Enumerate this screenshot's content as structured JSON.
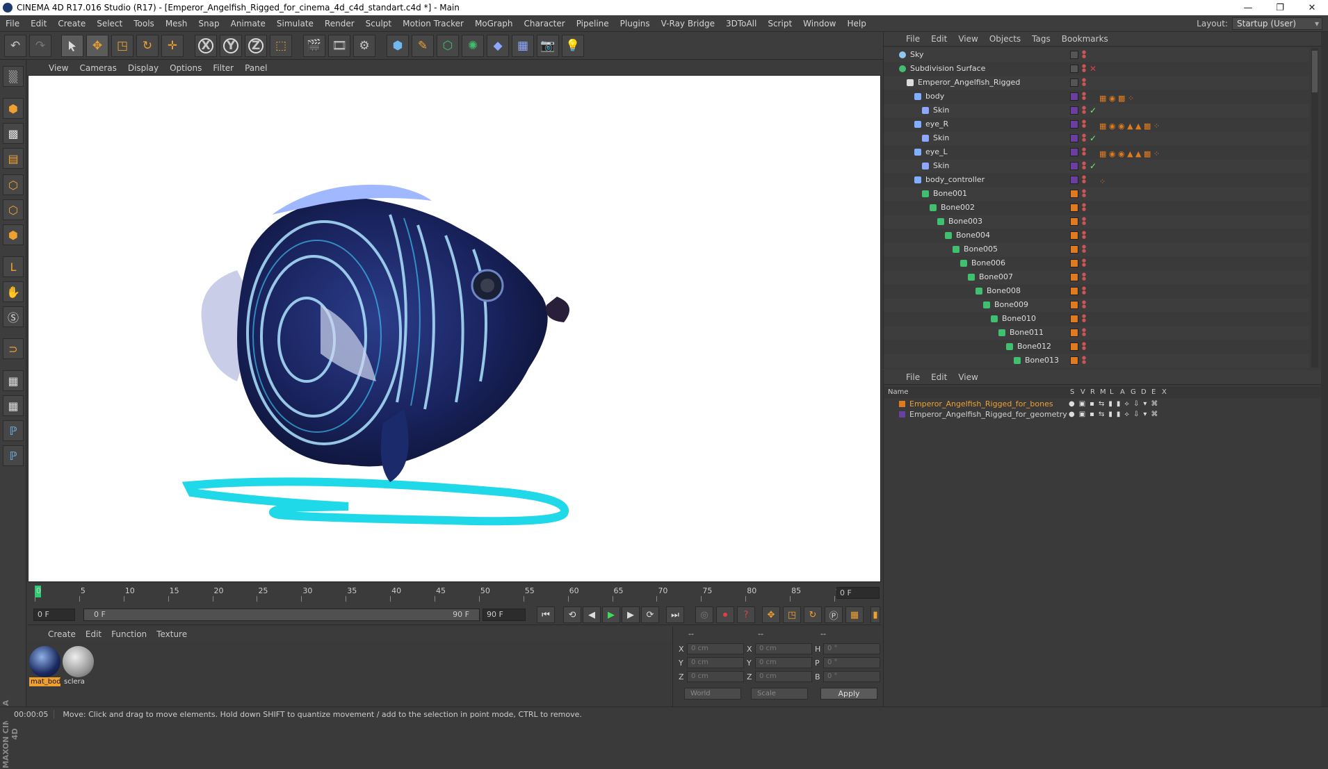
{
  "window": {
    "title": "CINEMA 4D R17.016 Studio (R17) - [Emperor_Angelfish_Rigged_for_cinema_4d_c4d_standart.c4d *] - Main"
  },
  "menubar": [
    "File",
    "Edit",
    "Create",
    "Select",
    "Tools",
    "Mesh",
    "Snap",
    "Animate",
    "Simulate",
    "Render",
    "Sculpt",
    "Motion Tracker",
    "MoGraph",
    "Character",
    "Pipeline",
    "Plugins",
    "V-Ray Bridge",
    "3DToAll",
    "Script",
    "Window",
    "Help"
  ],
  "layout": {
    "label": "Layout:",
    "value": "Startup (User)"
  },
  "toolbar_axes": [
    "X",
    "Y",
    "Z"
  ],
  "viewport": {
    "menu": [
      "View",
      "Cameras",
      "Display",
      "Options",
      "Filter",
      "Panel"
    ]
  },
  "timeline": {
    "ticks": [
      "0",
      "5",
      "10",
      "15",
      "20",
      "25",
      "30",
      "35",
      "40",
      "45",
      "50",
      "55",
      "60",
      "65",
      "70",
      "75",
      "80",
      "85",
      "90"
    ],
    "current_frame": "0 F"
  },
  "transport": {
    "start": "0 F",
    "range_start": "0 F",
    "range_end": "90 F",
    "end": "90 F"
  },
  "materials": {
    "menu": [
      "Create",
      "Edit",
      "Function",
      "Texture"
    ],
    "items": [
      {
        "name": "mat_bod"
      },
      {
        "name": "sclera"
      }
    ]
  },
  "coords": {
    "headers": [
      "--",
      "--",
      "--"
    ],
    "rows": [
      {
        "a": "X",
        "av": "0 cm",
        "b": "X",
        "bv": "0 cm",
        "c": "H",
        "cv": "0 °"
      },
      {
        "a": "Y",
        "av": "0 cm",
        "b": "Y",
        "bv": "0 cm",
        "c": "P",
        "cv": "0 °"
      },
      {
        "a": "Z",
        "av": "0 cm",
        "b": "Z",
        "bv": "0 cm",
        "c": "B",
        "cv": "0 °"
      }
    ],
    "mode": "World",
    "scale": "Scale",
    "apply": "Apply"
  },
  "status": {
    "time": "00:00:05",
    "message": "Move: Click and drag to move elements. Hold down SHIFT to quantize movement / add to the selection in point mode, CTRL to remove."
  },
  "object_manager": {
    "menu": [
      "File",
      "Edit",
      "View",
      "Objects",
      "Tags",
      "Bookmarks"
    ],
    "objects": [
      {
        "name": "Sky",
        "indent": 0,
        "kind": "sky"
      },
      {
        "name": "Subdivision Surface",
        "indent": 0,
        "kind": "subd"
      },
      {
        "name": "Emperor_Angelfish_Rigged",
        "indent": 1,
        "kind": "null"
      },
      {
        "name": "body",
        "indent": 2,
        "kind": "mesh"
      },
      {
        "name": "Skin",
        "indent": 3,
        "kind": "skin"
      },
      {
        "name": "eye_R",
        "indent": 2,
        "kind": "mesh"
      },
      {
        "name": "Skin",
        "indent": 3,
        "kind": "skin"
      },
      {
        "name": "eye_L",
        "indent": 2,
        "kind": "mesh"
      },
      {
        "name": "Skin",
        "indent": 3,
        "kind": "skin"
      },
      {
        "name": "body_controller",
        "indent": 2,
        "kind": "mesh"
      },
      {
        "name": "Bone001",
        "indent": 3,
        "kind": "bone"
      },
      {
        "name": "Bone002",
        "indent": 4,
        "kind": "bone"
      },
      {
        "name": "Bone003",
        "indent": 5,
        "kind": "bone"
      },
      {
        "name": "Bone004",
        "indent": 6,
        "kind": "bone"
      },
      {
        "name": "Bone005",
        "indent": 7,
        "kind": "bone"
      },
      {
        "name": "Bone006",
        "indent": 8,
        "kind": "bone"
      },
      {
        "name": "Bone007",
        "indent": 9,
        "kind": "bone"
      },
      {
        "name": "Bone008",
        "indent": 10,
        "kind": "bone"
      },
      {
        "name": "Bone009",
        "indent": 11,
        "kind": "bone"
      },
      {
        "name": "Bone010",
        "indent": 12,
        "kind": "bone"
      },
      {
        "name": "Bone011",
        "indent": 13,
        "kind": "bone"
      },
      {
        "name": "Bone012",
        "indent": 14,
        "kind": "bone"
      },
      {
        "name": "Bone013",
        "indent": 15,
        "kind": "bone"
      }
    ]
  },
  "layer_manager": {
    "menu": [
      "File",
      "Edit",
      "View"
    ],
    "columns": [
      "Name",
      "S",
      "V",
      "R",
      "M",
      "L",
      "A",
      "G",
      "D",
      "E",
      "X"
    ],
    "layers": [
      {
        "name": "Emperor_Angelfish_Rigged_for_bones",
        "color": "#e07a1f",
        "text_color": "#f0a030"
      },
      {
        "name": "Emperor_Angelfish_Rigged_for_geometry",
        "color": "#6b3fa0",
        "text_color": "#d0d0d0"
      }
    ]
  },
  "colors": {
    "accent": "#e07a1f",
    "bone_green": "#3fbf6f",
    "skin_check": "#6cf07a"
  }
}
